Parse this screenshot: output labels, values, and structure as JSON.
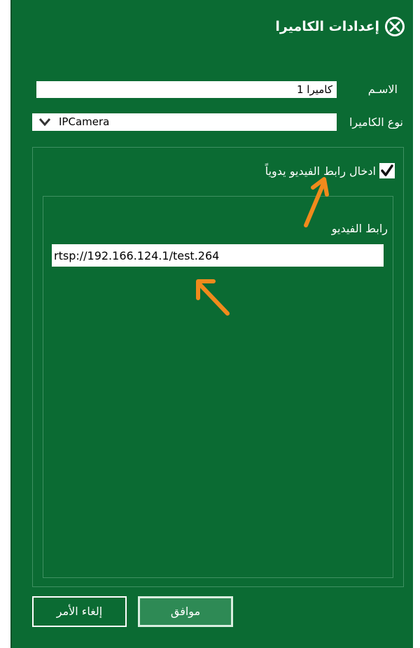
{
  "window": {
    "title": "إعدادات الكاميرا",
    "close_icon": "close-circle-icon"
  },
  "form": {
    "name_label": "الاسـم",
    "name_value": "كاميرا 1",
    "type_label": "نوع الكاميرا",
    "type_value": "IPCamera",
    "manual_checkbox_label": "ادخال رابط الفيديو يدوياً",
    "manual_checkbox_checked": true,
    "url_label": "رابط الفيديو",
    "url_value": "rtsp://192.166.124.1/test.264"
  },
  "buttons": {
    "ok_label": "موافق",
    "cancel_label": "إلغاء الأمر"
  },
  "colors": {
    "background": "#0b6b33",
    "annotation_arrow": "#f08a1c"
  }
}
